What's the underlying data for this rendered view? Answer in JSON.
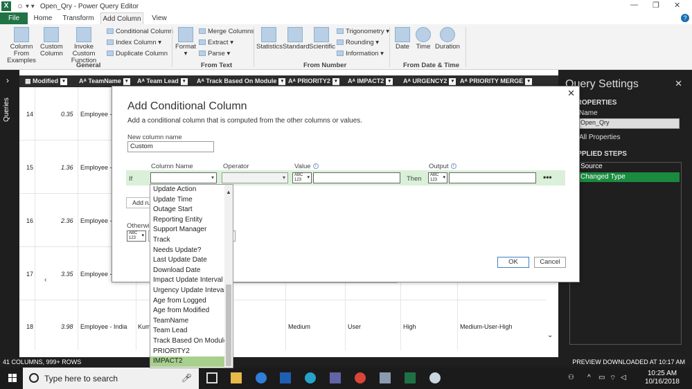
{
  "window": {
    "title": "Open_Qry - Power Query Editor",
    "app_badge": "X",
    "restore_glyph": "❐",
    "close_glyph": "✕"
  },
  "tabs": [
    {
      "label": "File"
    },
    {
      "label": "Home"
    },
    {
      "label": "Transform"
    },
    {
      "label": "Add Column"
    },
    {
      "label": "View"
    }
  ],
  "ribbon": {
    "general": {
      "group_label": "General",
      "column_from_examples": "Column From Examples",
      "custom_column": "Custom Column",
      "invoke_custom_function": "Invoke Custom Function",
      "conditional_column": "Conditional Column",
      "index_column": "Index Column",
      "duplicate_column": "Duplicate Column"
    },
    "from_text": {
      "group_label": "From Text",
      "format": "Format",
      "merge_columns": "Merge Columns",
      "extract": "Extract",
      "parse": "Parse"
    },
    "from_number": {
      "group_label": "From Number",
      "statistics": "Statistics",
      "standard": "Standard",
      "scientific": "Scientific",
      "trigonometry": "Trigonometry",
      "rounding": "Rounding",
      "information": "Information"
    },
    "from_date_time": {
      "group_label": "From Date & Time",
      "date": "Date",
      "time": "Time",
      "duration": "Duration"
    }
  },
  "leftnav": {
    "label": "Queries",
    "chevron": "›"
  },
  "grid": {
    "columns": [
      {
        "type_icon": "▦",
        "name": "Modified"
      },
      {
        "type_icon": "Aᴬ",
        "name": "TeamName"
      },
      {
        "type_icon": "Aᴬ",
        "name": "Team Lead"
      },
      {
        "type_icon": "Aᴬ",
        "name": "Track Based On Module"
      },
      {
        "type_icon": "Aᴬ",
        "name": "PRIORITY2"
      },
      {
        "type_icon": "Aᴬ",
        "name": "IMPACT2"
      },
      {
        "type_icon": "Aᴬ",
        "name": "URGENCY2"
      },
      {
        "type_icon": "Aᴬ",
        "name": "PRIORITY MERGE"
      }
    ],
    "rows": [
      {
        "num": "14",
        "value": "0.35",
        "team": "Employee - I"
      },
      {
        "num": "15",
        "value": "1.36",
        "team": "Employee - I"
      },
      {
        "num": "16",
        "value": "2.36",
        "team": "Employee - I"
      },
      {
        "num": "17",
        "value": "3.35",
        "team": "Employee - I"
      },
      {
        "num": "18",
        "value": "3.98",
        "team": "Employee - India",
        "lead": "Kum",
        "priority": "Medium",
        "impact": "User",
        "urgency": "High",
        "merge": "Medium-User-High"
      }
    ]
  },
  "query_settings": {
    "title": "Query Settings",
    "properties_header": "PROPERTIES",
    "name_label": "Name",
    "name_value": "Open_Qry",
    "all_properties": "All Properties",
    "applied_steps_header": "APPLIED STEPS",
    "steps": [
      "Source",
      "Changed Type"
    ]
  },
  "status": {
    "left": "41 COLUMNS, 999+ ROWS",
    "right": "PREVIEW DOWNLOADED AT 10:17 AM"
  },
  "taskbar": {
    "search_placeholder": "Type here to search",
    "time": "10:25 AM",
    "date": "10/16/2018"
  },
  "dialog": {
    "title": "Add Conditional Column",
    "subtitle": "Add a conditional column that is computed from the other columns or values.",
    "new_column_label": "New column name",
    "new_column_value": "Custom",
    "col_header_column": "Column Name",
    "col_header_operator": "Operator",
    "col_header_value": "Value",
    "col_header_output": "Output",
    "if_label": "If",
    "then_label": "Then",
    "add_rule": "Add rule",
    "otherwise_label": "Otherwise",
    "type_abc": "ABC",
    "type_123": "123",
    "ok": "OK",
    "cancel": "Cancel",
    "more": "•••"
  },
  "dropdown": {
    "items": [
      "Update Action",
      "Update Time",
      "Outage Start",
      "Reporting Entity",
      "Support Manager",
      "Track",
      "Needs Update?",
      "Last Update Date",
      "Download Date",
      "Impact Update Interval",
      "Urgency Update Inteval",
      "Age from Logged",
      "Age from Modified",
      "TeamName",
      "Team Lead",
      "Track Based On Module",
      "PRIORITY2",
      "IMPACT2"
    ],
    "highlighted": "IMPACT2"
  }
}
